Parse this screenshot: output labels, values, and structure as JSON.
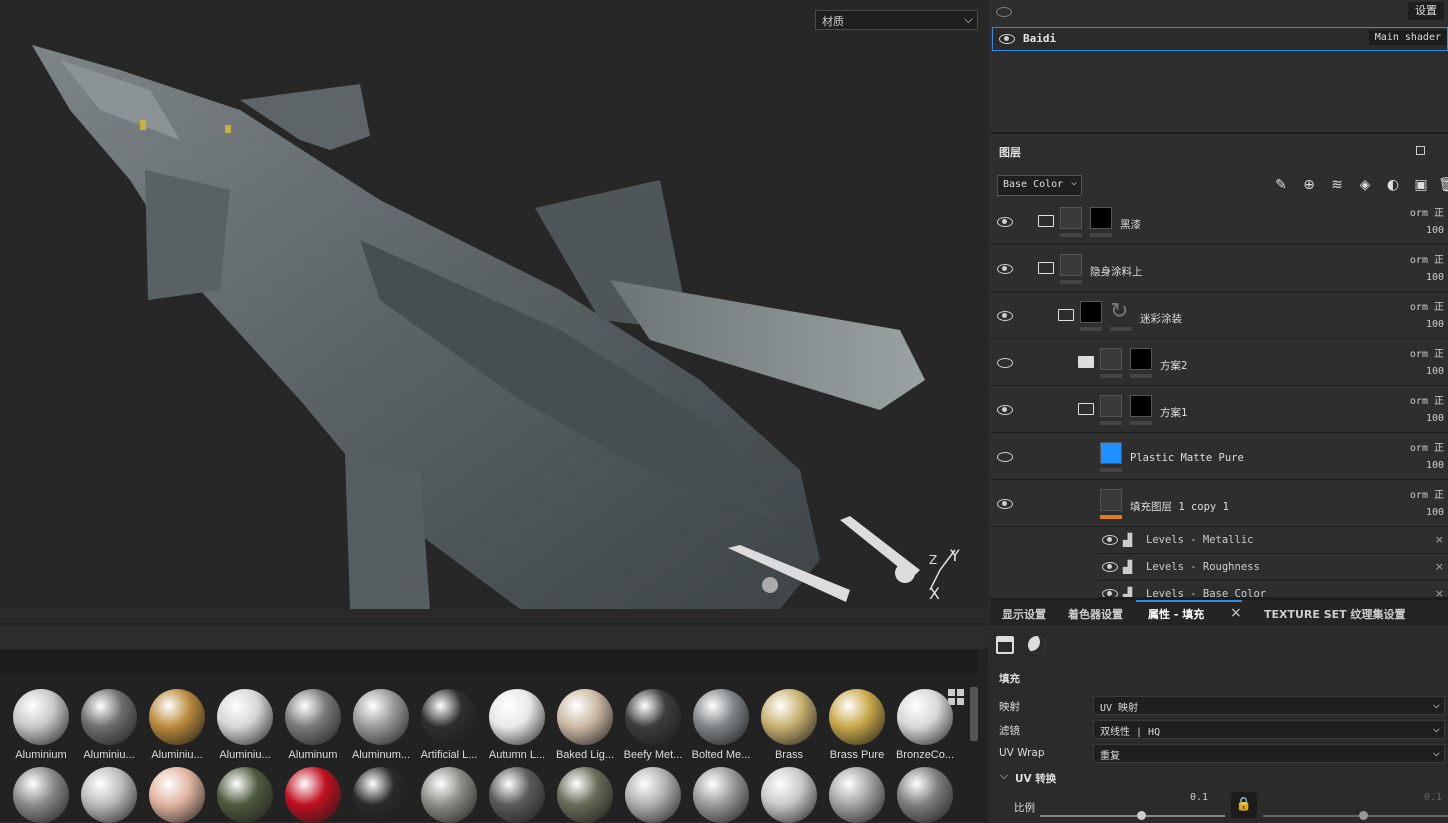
{
  "viewport": {
    "channel_select": "材质",
    "gizmo": {
      "y": "Y",
      "z": "Z",
      "x": "X"
    }
  },
  "shaders": {
    "settings_label": "设置",
    "shader_name": "Baidi",
    "shader_tag": "Main shader"
  },
  "layers": {
    "title": "图层",
    "channel": "Base Color",
    "items": [
      {
        "name": "黑漆",
        "blend": "orm 正",
        "opacity": "100"
      },
      {
        "name": "隐身涂料上",
        "blend": "orm 正",
        "opacity": "100"
      },
      {
        "name": "迷彩涂装",
        "blend": "orm 正",
        "opacity": "100"
      },
      {
        "name": "方案2",
        "blend": "orm 正",
        "opacity": "100"
      },
      {
        "name": "方案1",
        "blend": "orm 正",
        "opacity": "100"
      },
      {
        "name": "Plastic Matte Pure",
        "blend": "orm 正",
        "opacity": "100"
      },
      {
        "name": "填充图层 1 copy 1",
        "blend": "orm 正",
        "opacity": "100"
      }
    ],
    "effects": [
      {
        "name": "Levels - Metallic"
      },
      {
        "name": "Levels - Roughness"
      },
      {
        "name": "Levels - Base Color"
      }
    ]
  },
  "props": {
    "tabs": [
      "显示设置",
      "着色器设置",
      "属性 - 填充",
      "TEXTURE SET 纹理集设置"
    ],
    "section_title": "填充",
    "rows": [
      {
        "label": "映射",
        "value": "UV 映射"
      },
      {
        "label": "滤镜",
        "value": "双线性 | HQ"
      },
      {
        "label": "UV Wrap",
        "value": "重复"
      }
    ],
    "uv_transform": "UV 转换",
    "scale_label": "比例",
    "scale_value": "0.1",
    "scale_value2": "0.1"
  },
  "shelf": {
    "row1": [
      {
        "name": "Aluminium",
        "color": "#c8c8c8"
      },
      {
        "name": "Aluminiu...",
        "color": "#6e6e6e"
      },
      {
        "name": "Aluminiu...",
        "color": "#b98a3c"
      },
      {
        "name": "Aluminiu...",
        "color": "#d6d6d6"
      },
      {
        "name": "Aluminum",
        "color": "#7a7a7a"
      },
      {
        "name": "Aluminum...",
        "color": "#9a9a9a"
      },
      {
        "name": "Artificial L...",
        "color": "#2e2e2e"
      },
      {
        "name": "Autumn L...",
        "color": "#e8e8e8"
      },
      {
        "name": "Baked Lig...",
        "color": "#cbb9a3"
      },
      {
        "name": "Beefy Met...",
        "color": "#3c3c3c"
      },
      {
        "name": "Bolted Me...",
        "color": "#7f8588"
      },
      {
        "name": "Brass",
        "color": "#c8b070"
      },
      {
        "name": "Brass Pure",
        "color": "#c9a84a"
      },
      {
        "name": "BronzeCo...",
        "color": "#d8d8d8"
      }
    ],
    "row2": [
      {
        "color": "#8a8a8a"
      },
      {
        "color": "#bcbcbc"
      },
      {
        "color": "#e0b3a0"
      },
      {
        "color": "#4e5a3e"
      },
      {
        "color": "#c01020"
      },
      {
        "color": "#2a2a2a"
      },
      {
        "color": "#8c8c86"
      },
      {
        "color": "#5a5a5a"
      },
      {
        "color": "#6a6a58"
      },
      {
        "color": "#b0b0b0"
      },
      {
        "color": "#9a9a9a"
      },
      {
        "color": "#c8c8c8"
      },
      {
        "color": "#a4a4a4"
      },
      {
        "color": "#7e7e7e"
      }
    ]
  }
}
